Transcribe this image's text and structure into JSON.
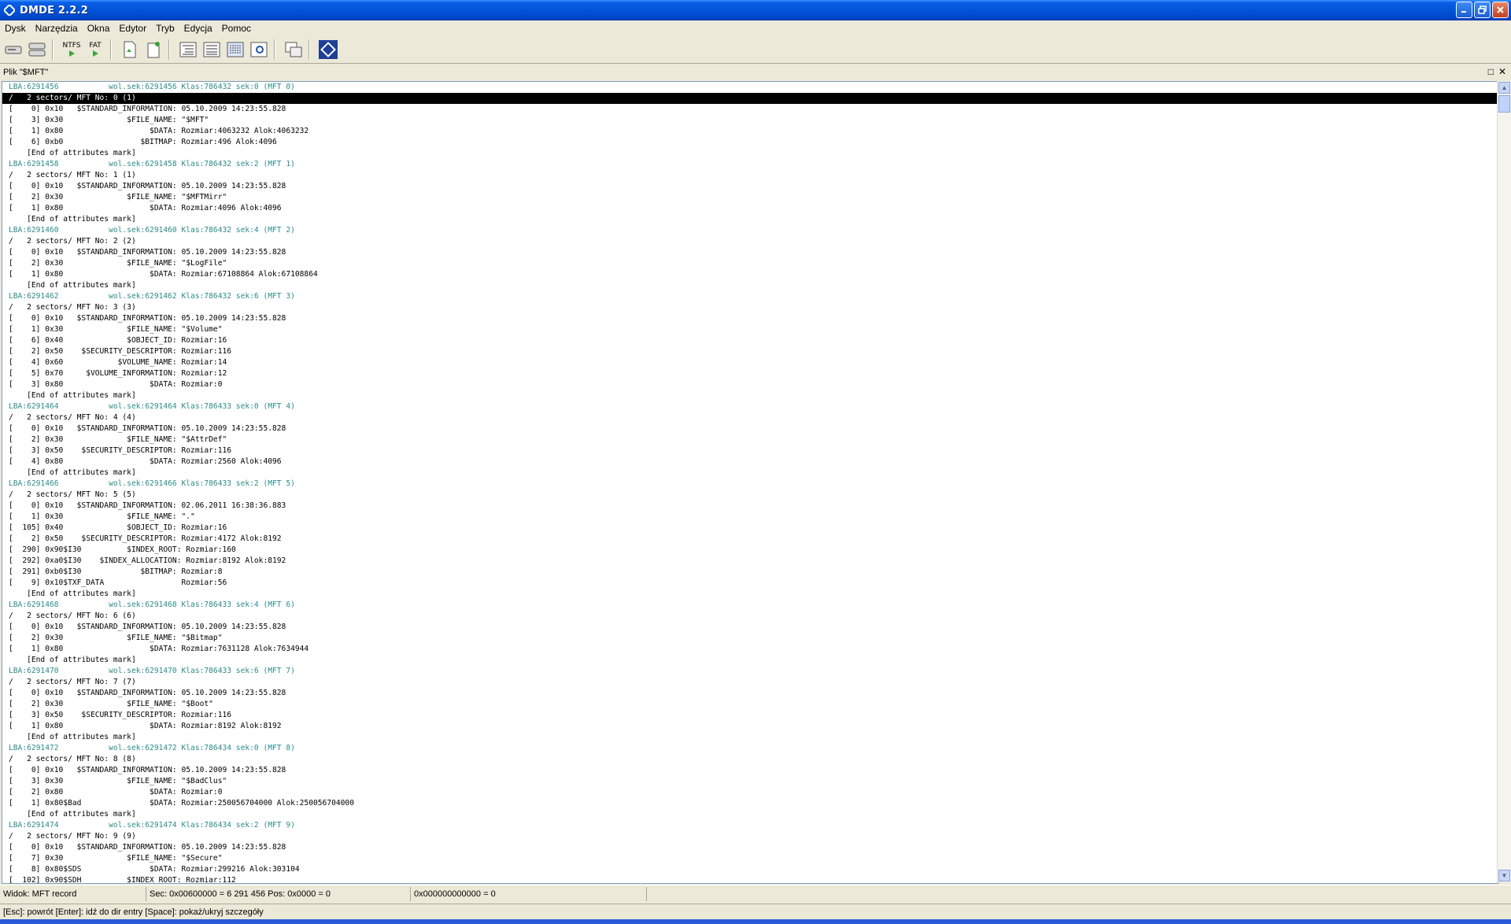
{
  "window": {
    "title": "DMDE 2.2.2"
  },
  "menu": [
    "Dysk",
    "Narzędzia",
    "Okna",
    "Edytor",
    "Tryb",
    "Edycja",
    "Pomoc"
  ],
  "toolbar": {
    "ntfs_label": "NTFS",
    "fat_label": "FAT"
  },
  "panel": {
    "title": "Plik \"$MFT\""
  },
  "lines": [
    {
      "t": "LBA:6291456           wol.sek:6291456 Klas:786432 sek:0 (MFT 0)",
      "k": "lba"
    },
    {
      "t": "/   2 sectors/ MFT No: 0 (1)",
      "k": "sel"
    },
    {
      "t": "[    0] 0x10   $STANDARD_INFORMATION: 05.10.2009 14:23:55.828",
      "k": ""
    },
    {
      "t": "[    3] 0x30              $FILE_NAME: \"$MFT\"",
      "k": ""
    },
    {
      "t": "[    1] 0x80                   $DATA: Rozmiar:4063232 Alok:4063232",
      "k": ""
    },
    {
      "t": "[    6] 0xb0                 $BITMAP: Rozmiar:496 Alok:4096",
      "k": ""
    },
    {
      "t": "    [End of attributes mark]",
      "k": ""
    },
    {
      "t": "LBA:6291458           wol.sek:6291458 Klas:786432 sek:2 (MFT 1)",
      "k": "lba"
    },
    {
      "t": "/   2 sectors/ MFT No: 1 (1)",
      "k": ""
    },
    {
      "t": "[    0] 0x10   $STANDARD_INFORMATION: 05.10.2009 14:23:55.828",
      "k": ""
    },
    {
      "t": "[    2] 0x30              $FILE_NAME: \"$MFTMirr\"",
      "k": ""
    },
    {
      "t": "[    1] 0x80                   $DATA: Rozmiar:4096 Alok:4096",
      "k": ""
    },
    {
      "t": "    [End of attributes mark]",
      "k": ""
    },
    {
      "t": "LBA:6291460           wol.sek:6291460 Klas:786432 sek:4 (MFT 2)",
      "k": "lba"
    },
    {
      "t": "/   2 sectors/ MFT No: 2 (2)",
      "k": ""
    },
    {
      "t": "[    0] 0x10   $STANDARD_INFORMATION: 05.10.2009 14:23:55.828",
      "k": ""
    },
    {
      "t": "[    2] 0x30              $FILE_NAME: \"$LogFile\"",
      "k": ""
    },
    {
      "t": "[    1] 0x80                   $DATA: Rozmiar:67108864 Alok:67108864",
      "k": ""
    },
    {
      "t": "    [End of attributes mark]",
      "k": ""
    },
    {
      "t": "LBA:6291462           wol.sek:6291462 Klas:786432 sek:6 (MFT 3)",
      "k": "lba"
    },
    {
      "t": "/   2 sectors/ MFT No: 3 (3)",
      "k": ""
    },
    {
      "t": "[    0] 0x10   $STANDARD_INFORMATION: 05.10.2009 14:23:55.828",
      "k": ""
    },
    {
      "t": "[    1] 0x30              $FILE_NAME: \"$Volume\"",
      "k": ""
    },
    {
      "t": "[    6] 0x40              $OBJECT_ID: Rozmiar:16",
      "k": ""
    },
    {
      "t": "[    2] 0x50    $SECURITY_DESCRIPTOR: Rozmiar:116",
      "k": ""
    },
    {
      "t": "[    4] 0x60            $VOLUME_NAME: Rozmiar:14",
      "k": ""
    },
    {
      "t": "[    5] 0x70     $VOLUME_INFORMATION: Rozmiar:12",
      "k": ""
    },
    {
      "t": "[    3] 0x80                   $DATA: Rozmiar:0",
      "k": ""
    },
    {
      "t": "    [End of attributes mark]",
      "k": ""
    },
    {
      "t": "LBA:6291464           wol.sek:6291464 Klas:786433 sek:0 (MFT 4)",
      "k": "lba"
    },
    {
      "t": "/   2 sectors/ MFT No: 4 (4)",
      "k": ""
    },
    {
      "t": "[    0] 0x10   $STANDARD_INFORMATION: 05.10.2009 14:23:55.828",
      "k": ""
    },
    {
      "t": "[    2] 0x30              $FILE_NAME: \"$AttrDef\"",
      "k": ""
    },
    {
      "t": "[    3] 0x50    $SECURITY_DESCRIPTOR: Rozmiar:116",
      "k": ""
    },
    {
      "t": "[    4] 0x80                   $DATA: Rozmiar:2560 Alok:4096",
      "k": ""
    },
    {
      "t": "    [End of attributes mark]",
      "k": ""
    },
    {
      "t": "LBA:6291466           wol.sek:6291466 Klas:786433 sek:2 (MFT 5)",
      "k": "lba"
    },
    {
      "t": "/   2 sectors/ MFT No: 5 (5)",
      "k": ""
    },
    {
      "t": "[    0] 0x10   $STANDARD_INFORMATION: 02.06.2011 16:38:36.883",
      "k": ""
    },
    {
      "t": "[    1] 0x30              $FILE_NAME: \".\"",
      "k": ""
    },
    {
      "t": "[  105] 0x40              $OBJECT_ID: Rozmiar:16",
      "k": ""
    },
    {
      "t": "[    2] 0x50    $SECURITY_DESCRIPTOR: Rozmiar:4172 Alok:8192",
      "k": ""
    },
    {
      "t": "[  290] 0x90$I30          $INDEX_ROOT: Rozmiar:160",
      "k": ""
    },
    {
      "t": "[  292] 0xa0$I30    $INDEX_ALLOCATION: Rozmiar:8192 Alok:8192",
      "k": ""
    },
    {
      "t": "[  291] 0xb0$I30             $BITMAP: Rozmiar:8",
      "k": ""
    },
    {
      "t": "[    9] 0x10$TXF_DATA                 Rozmiar:56",
      "k": ""
    },
    {
      "t": "    [End of attributes mark]",
      "k": ""
    },
    {
      "t": "LBA:6291468           wol.sek:6291468 Klas:786433 sek:4 (MFT 6)",
      "k": "lba"
    },
    {
      "t": "/   2 sectors/ MFT No: 6 (6)",
      "k": ""
    },
    {
      "t": "[    0] 0x10   $STANDARD_INFORMATION: 05.10.2009 14:23:55.828",
      "k": ""
    },
    {
      "t": "[    2] 0x30              $FILE_NAME: \"$Bitmap\"",
      "k": ""
    },
    {
      "t": "[    1] 0x80                   $DATA: Rozmiar:7631128 Alok:7634944",
      "k": ""
    },
    {
      "t": "    [End of attributes mark]",
      "k": ""
    },
    {
      "t": "LBA:6291470           wol.sek:6291470 Klas:786433 sek:6 (MFT 7)",
      "k": "lba"
    },
    {
      "t": "/   2 sectors/ MFT No: 7 (7)",
      "k": ""
    },
    {
      "t": "[    0] 0x10   $STANDARD_INFORMATION: 05.10.2009 14:23:55.828",
      "k": ""
    },
    {
      "t": "[    2] 0x30              $FILE_NAME: \"$Boot\"",
      "k": ""
    },
    {
      "t": "[    3] 0x50    $SECURITY_DESCRIPTOR: Rozmiar:116",
      "k": ""
    },
    {
      "t": "[    1] 0x80                   $DATA: Rozmiar:8192 Alok:8192",
      "k": ""
    },
    {
      "t": "    [End of attributes mark]",
      "k": ""
    },
    {
      "t": "LBA:6291472           wol.sek:6291472 Klas:786434 sek:0 (MFT 8)",
      "k": "lba"
    },
    {
      "t": "/   2 sectors/ MFT No: 8 (8)",
      "k": ""
    },
    {
      "t": "[    0] 0x10   $STANDARD_INFORMATION: 05.10.2009 14:23:55.828",
      "k": ""
    },
    {
      "t": "[    3] 0x30              $FILE_NAME: \"$BadClus\"",
      "k": ""
    },
    {
      "t": "[    2] 0x80                   $DATA: Rozmiar:0",
      "k": ""
    },
    {
      "t": "[    1] 0x80$Bad               $DATA: Rozmiar:250056704000 Alok:250056704000",
      "k": ""
    },
    {
      "t": "    [End of attributes mark]",
      "k": ""
    },
    {
      "t": "LBA:6291474           wol.sek:6291474 Klas:786434 sek:2 (MFT 9)",
      "k": "lba"
    },
    {
      "t": "/   2 sectors/ MFT No: 9 (9)",
      "k": ""
    },
    {
      "t": "[    0] 0x10   $STANDARD_INFORMATION: 05.10.2009 14:23:55.828",
      "k": ""
    },
    {
      "t": "[    7] 0x30              $FILE_NAME: \"$Secure\"",
      "k": ""
    },
    {
      "t": "[    8] 0x80$SDS               $DATA: Rozmiar:299216 Alok:303104",
      "k": ""
    },
    {
      "t": "[  102] 0x90$SDH          $INDEX_ROOT: Rozmiar:112",
      "k": ""
    }
  ],
  "status": {
    "view": "Widok: MFT record",
    "sec": "Sec: 0x00600000 = 6 291 456  Pos: 0x0000 = 0",
    "offset": "0x000000000000 = 0"
  },
  "help": "[Esc]: powrót  [Enter]: idź do dir entry  [Space]: pokaż/ukryj szczegóły",
  "colors": {
    "lba_line": "#2e8b8b",
    "selection": "#000000",
    "titlebar": "#0254d7"
  }
}
